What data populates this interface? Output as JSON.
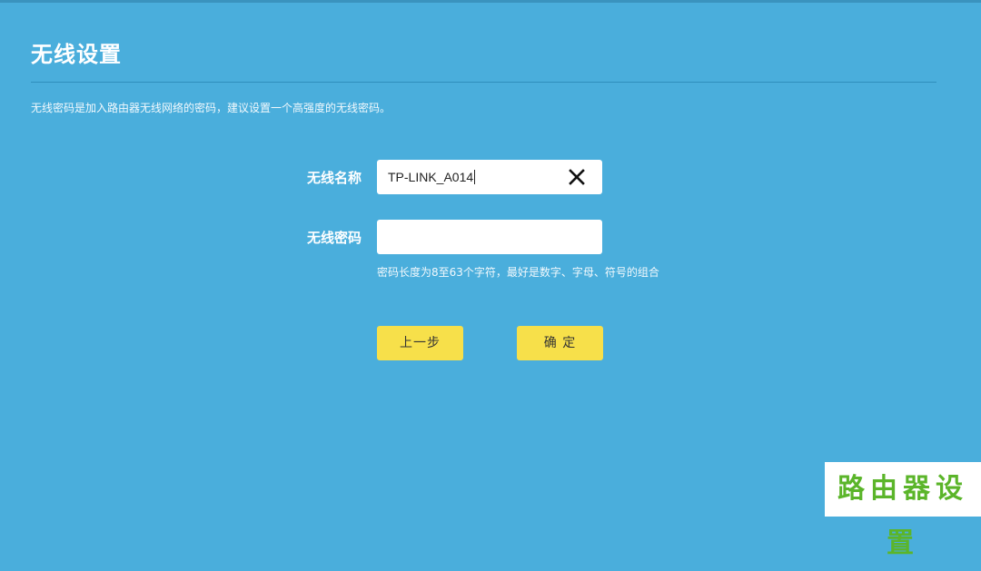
{
  "page": {
    "title": "无线设置",
    "description": "无线密码是加入路由器无线网络的密码，建议设置一个高强度的无线密码。"
  },
  "form": {
    "ssid_label": "无线名称",
    "ssid_value": "TP-LINK_A014",
    "password_label": "无线密码",
    "password_value": "",
    "password_hint": "密码长度为8至63个字符，最好是数字、字母、符号的组合"
  },
  "buttons": {
    "back_label": "上一步",
    "confirm_label": "确 定"
  },
  "watermark": {
    "text": "路由器设置"
  },
  "icons": {
    "clear": "close-icon"
  },
  "colors": {
    "background": "#4aaedc",
    "button": "#f7e04a",
    "watermark": "#5bb52a"
  }
}
